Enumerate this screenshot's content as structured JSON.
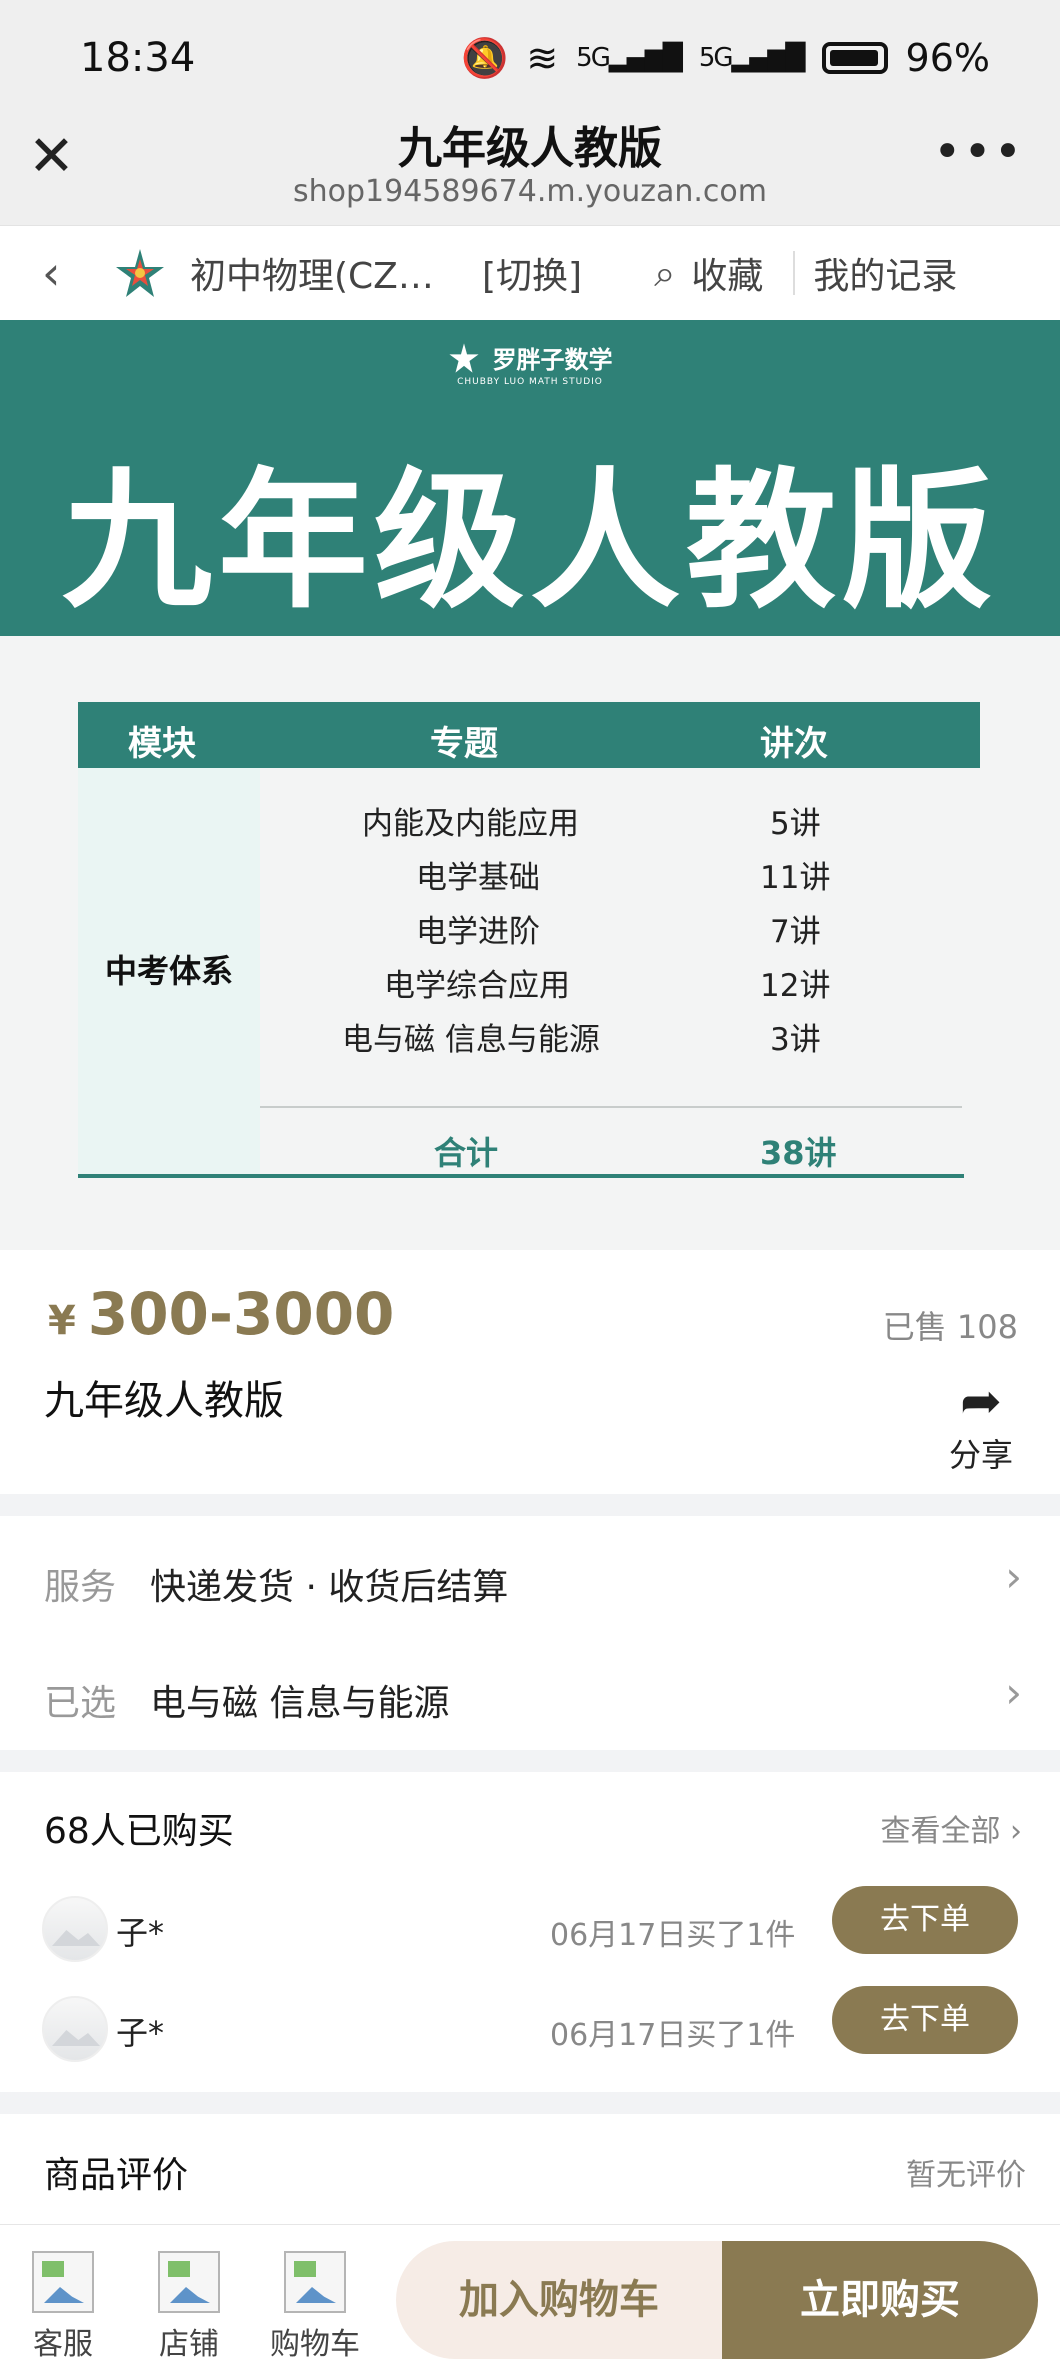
{
  "status_bar": {
    "time": "18:34",
    "signal1": "5G",
    "signal2": "5G",
    "battery": "96%"
  },
  "browser": {
    "title": "九年级人教版",
    "url": "shop194589674.m.youzan.com"
  },
  "shop_nav": {
    "shop_name": "初中物理(CZ…",
    "switch_label": "[切换]",
    "favorite_label": "收藏",
    "records_label": "我的记录"
  },
  "banner": {
    "brand_name": "罗胖子数学",
    "brand_sub": "CHUBBY LUO MATH STUDIO",
    "title": "九年级人教版",
    "table": {
      "headers": [
        "模块",
        "专题",
        "讲次"
      ],
      "module": "中考体系",
      "rows": [
        {
          "topic": "内能及内能应用",
          "count": "5讲"
        },
        {
          "topic": "电学基础",
          "count": "11讲"
        },
        {
          "topic": "电学进阶",
          "count": "7讲"
        },
        {
          "topic": "电学综合应用",
          "count": "12讲"
        },
        {
          "topic": "电与磁 信息与能源",
          "count": "3讲"
        }
      ],
      "total_label": "合计",
      "total_value": "38讲"
    }
  },
  "product": {
    "currency": "¥",
    "price": "300-3000",
    "sold": "已售 108",
    "title": "九年级人教版",
    "share_label": "分享"
  },
  "service": {
    "rows": [
      {
        "key": "服务",
        "value": "快递发货 · 收货后结算"
      },
      {
        "key": "已选",
        "value": "电与磁 信息与能源"
      }
    ]
  },
  "purchases": {
    "title": "68人已购买",
    "view_all": "查看全部",
    "buyers": [
      {
        "name": "子*",
        "date": "06月17日买了1件",
        "button": "去下单"
      },
      {
        "name": "子*",
        "date": "06月17日买了1件",
        "button": "去下单"
      }
    ]
  },
  "reviews": {
    "title": "商品评价",
    "status": "暂无评价"
  },
  "bottom_bar": {
    "tabs": [
      "客服",
      "店铺",
      "购物车"
    ],
    "add_to_cart": "加入购物车",
    "buy_now": "立即购买"
  },
  "colors": {
    "brand_green": "#2f8177",
    "accent_gold": "#8a7a52",
    "cart_bg": "#f6ece6"
  }
}
